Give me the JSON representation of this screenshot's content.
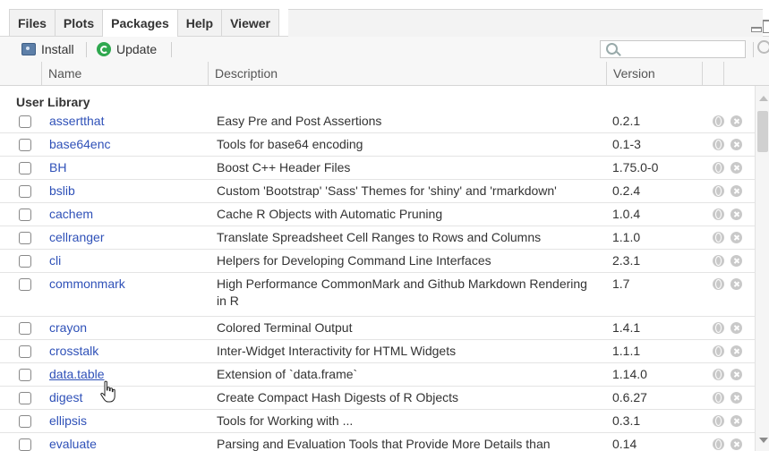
{
  "tabs": [
    "Files",
    "Plots",
    "Packages",
    "Help",
    "Viewer"
  ],
  "active_tab": "Packages",
  "toolbar": {
    "install_label": "Install",
    "update_label": "Update"
  },
  "search": {
    "placeholder": ""
  },
  "columns": {
    "name": "Name",
    "description": "Description",
    "version": "Version"
  },
  "section_title": "User Library",
  "packages": [
    {
      "name": "assertthat",
      "description": "Easy Pre and Post Assertions",
      "version": "0.2.1"
    },
    {
      "name": "base64enc",
      "description": "Tools for base64 encoding",
      "version": "0.1-3"
    },
    {
      "name": "BH",
      "description": "Boost C++ Header Files",
      "version": "1.75.0-0"
    },
    {
      "name": "bslib",
      "description": "Custom 'Bootstrap' 'Sass' Themes for 'shiny' and 'rmarkdown'",
      "version": "0.2.4"
    },
    {
      "name": "cachem",
      "description": "Cache R Objects with Automatic Pruning",
      "version": "1.0.4"
    },
    {
      "name": "cellranger",
      "description": "Translate Spreadsheet Cell Ranges to Rows and Columns",
      "version": "1.1.0"
    },
    {
      "name": "cli",
      "description": "Helpers for Developing Command Line Interfaces",
      "version": "2.3.1"
    },
    {
      "name": "commonmark",
      "description": "High Performance CommonMark and Github Markdown Rendering in R",
      "version": "1.7"
    },
    {
      "name": "crayon",
      "description": "Colored Terminal Output",
      "version": "1.4.1"
    },
    {
      "name": "crosstalk",
      "description": "Inter-Widget Interactivity for HTML Widgets",
      "version": "1.1.1"
    },
    {
      "name": "data.table",
      "description": "Extension of `data.frame`",
      "version": "1.14.0"
    },
    {
      "name": "digest",
      "description": "Create Compact Hash Digests of R Objects",
      "version": "0.6.27"
    },
    {
      "name": "ellipsis",
      "description": "Tools for Working with ...",
      "version": "0.3.1"
    },
    {
      "name": "evaluate",
      "description": "Parsing and Evaluation Tools that Provide More Details than",
      "version": "0.14"
    }
  ]
}
